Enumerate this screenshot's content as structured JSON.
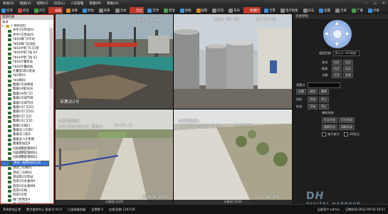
{
  "menubar": {
    "items": [
      "系统(S)",
      "视图(V)",
      "控制(C)",
      "日志(L)",
      "人员管理",
      "管理(M)",
      "帮助(H)"
    ],
    "window_controls": [
      "–",
      "▫",
      "✕"
    ]
  },
  "toolbar": {
    "items": [
      {
        "label": "监测",
        "color": "#3f8fd8",
        "active": false
      },
      {
        "label": "退出",
        "color": "#c94b4b",
        "active": false
      },
      {
        "label": "开启",
        "color": "#49a04a",
        "active": false
      },
      {
        "label": "画面",
        "color": "#c0392b",
        "active": true
      },
      {
        "label": "录像",
        "color": "#d88a2a",
        "active": false
      },
      {
        "label": "抓拍",
        "color": "#3f8fd8",
        "active": false
      },
      {
        "label": "查看",
        "color": "#888888",
        "active": false
      },
      {
        "label": "全屏",
        "color": "#888888",
        "active": false
      },
      {
        "label": "云台",
        "color": "#c0392b",
        "active": true
      },
      {
        "label": "实时",
        "color": "#3f8fd8",
        "active": false
      },
      {
        "label": "回放",
        "color": "#49a04a",
        "active": false
      },
      {
        "label": "地图",
        "color": "#3f8fd8",
        "active": false
      },
      {
        "label": "报警",
        "color": "#d88a2a",
        "active": false
      },
      {
        "label": "轮巡",
        "color": "#888888",
        "active": false
      },
      {
        "label": "布局",
        "color": "#888888",
        "active": false
      },
      {
        "label": "轮播行",
        "color": "#c0392b",
        "active": true
      },
      {
        "label": "告警",
        "color": "#3f8fd8",
        "active": false
      },
      {
        "label": "电子地图",
        "color": "#888888",
        "active": false
      },
      {
        "label": "日志",
        "color": "#888888",
        "active": false
      },
      {
        "label": "配置",
        "color": "#3f8fd8",
        "active": false
      },
      {
        "label": "全屏",
        "color": "#888888",
        "active": false
      },
      {
        "label": "广播",
        "color": "#49a04a",
        "active": false
      },
      {
        "label": "对讲",
        "color": "#3f8fd8",
        "active": false
      }
    ]
  },
  "left_panel": {
    "title": "资源列表",
    "subtitle": "查询",
    "tree": [
      {
        "label": "1 视频监控",
        "root": true
      },
      {
        "label": "水中1号泵站01"
      },
      {
        "label": "水中1号泵站02"
      },
      {
        "label": "YbS4阀门4号站"
      },
      {
        "label": "YbS4阀门北站区"
      },
      {
        "label": "YbS4#泵门5 01泵"
      },
      {
        "label": "YbS4#泵门站 02"
      },
      {
        "label": "YbS4#泵门站 03"
      },
      {
        "label": "YbS4计量泵站"
      },
      {
        "label": "YbS4计量阀站"
      },
      {
        "label": "计量泵3机1泵站"
      },
      {
        "label": "YbU泵01"
      },
      {
        "label": "YbU阀02"
      },
      {
        "label": "集输1号站阀组"
      },
      {
        "label": "集输1#配水间"
      },
      {
        "label": "集输1#西门口"
      },
      {
        "label": "集输1号调节阀"
      },
      {
        "label": "集输1号调节间"
      },
      {
        "label": "集输1号门口01"
      },
      {
        "label": "集输1号门口02"
      },
      {
        "label": "集输1号门口C"
      },
      {
        "label": "集输1号门口D"
      },
      {
        "label": "集输1号阀口"
      },
      {
        "label": "集输北-1号泵C"
      },
      {
        "label": "集输北-1泵D"
      },
      {
        "label": "集输北-1大泵阀"
      },
      {
        "label": "集输泵站区B"
      },
      {
        "label": "A国调整配管阀01"
      },
      {
        "label": "A国调整配管阀02"
      },
      {
        "label": "A国调整配管阀03"
      },
      {
        "label": "测试一报警站点126",
        "selected": true
      },
      {
        "label": "测试二号阀01"
      },
      {
        "label": "测试二号阀02"
      },
      {
        "label": "测试南1号泵站"
      },
      {
        "label": "西部3号水源井A"
      },
      {
        "label": "西部3号水源井B"
      },
      {
        "label": "西部3号阀"
      },
      {
        "label": "西部3号泵"
      },
      {
        "label": "阀门控制室A"
      },
      {
        "label": "阀门控制室B"
      },
      {
        "label": "北新加人员"
      },
      {
        "label": "清水泵站DC31"
      },
      {
        "label": "清水泵站DC32"
      }
    ]
  },
  "video": {
    "panes": [
      {
        "date": "2022-09-04",
        "time": "",
        "name": "采集站1号",
        "caption": "采集站1号门口01"
      },
      {
        "date": "2022-09-04",
        "time": "19:24:38",
        "name": "",
        "caption": "罐区1号"
      },
      {
        "date": "2022年09月03日 星期六",
        "time": "20:07:25",
        "name": "水源地监控1",
        "caption": "水源站门口05"
      },
      {
        "date": "2022年09月03日 星期六",
        "time": "20:07:25",
        "name": "水源站监控1",
        "caption": "水源站门口04"
      }
    ],
    "bottom_names": [
      "水源站门口05",
      "IV 井门04"
    ]
  },
  "right_panel": {
    "title": "云台控制",
    "speed_label": "速度控制",
    "speed_value": "默认(1-100速度)",
    "rows": [
      {
        "label": "变倍",
        "a": "拉近",
        "b": "拉远"
      },
      {
        "label": "聚焦",
        "a": "拉近",
        "b": "拉远"
      },
      {
        "label": "光圈",
        "a": "打开",
        "b": "关闭"
      }
    ],
    "preset_label": "预置点",
    "preset_value": "",
    "preset_buttons": [
      "设置",
      "调用",
      "删除"
    ],
    "cruise_label": "巡航",
    "cruise_buttons": [
      "开始",
      "停止"
    ],
    "track_label": "轨迹",
    "track_buttons": [
      "开始",
      "停止"
    ],
    "group_label": "辅助控制",
    "light_buttons": [
      "灯光开启",
      "灯光关闭"
    ],
    "wiper_buttons": [
      "雨刷开启",
      "雨刷关闭"
    ],
    "checks": [
      "电子放大",
      "3D定位"
    ]
  },
  "status": {
    "items": [
      "系统状态正常",
      "数字监控中心 版本号:V1.0",
      "已连接服务器",
      "告警数 0",
      "在线/总数 126/126"
    ],
    "right": [
      "当前用户:admin",
      "日期时间:2022-09-03 20:07"
    ]
  },
  "watermark": {
    "main": "DH",
    "sub": "DIGITAL HARBOUR"
  },
  "colors": {
    "accent": "#c0392b",
    "selected": "#3875d7",
    "tree_icon": "#2d6b2d"
  }
}
